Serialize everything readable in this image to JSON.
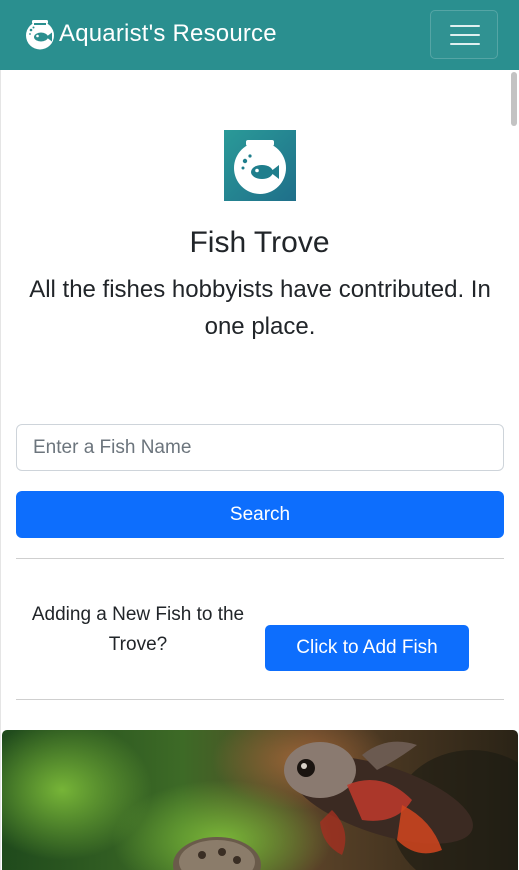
{
  "navbar": {
    "brand_icon": "fishbowl-icon",
    "brand_text": "Aquarist's Resource",
    "toggle_icon": "hamburger-menu-icon",
    "background": "#2a8f8f"
  },
  "hero": {
    "logo_icon": "fishbowl-logo-icon",
    "title": "Fish Trove",
    "lead": "All the fishes hobbyists have contributed. In one place."
  },
  "search": {
    "placeholder": "Enter a Fish Name",
    "value": "",
    "button_label": "Search",
    "button_color": "#0d6efd"
  },
  "add_fish": {
    "prompt": "Adding a New Fish to the Trove?",
    "button_label": "Click to Add Fish"
  },
  "feature_image": {
    "subject": "aquarium-fish-photo"
  }
}
